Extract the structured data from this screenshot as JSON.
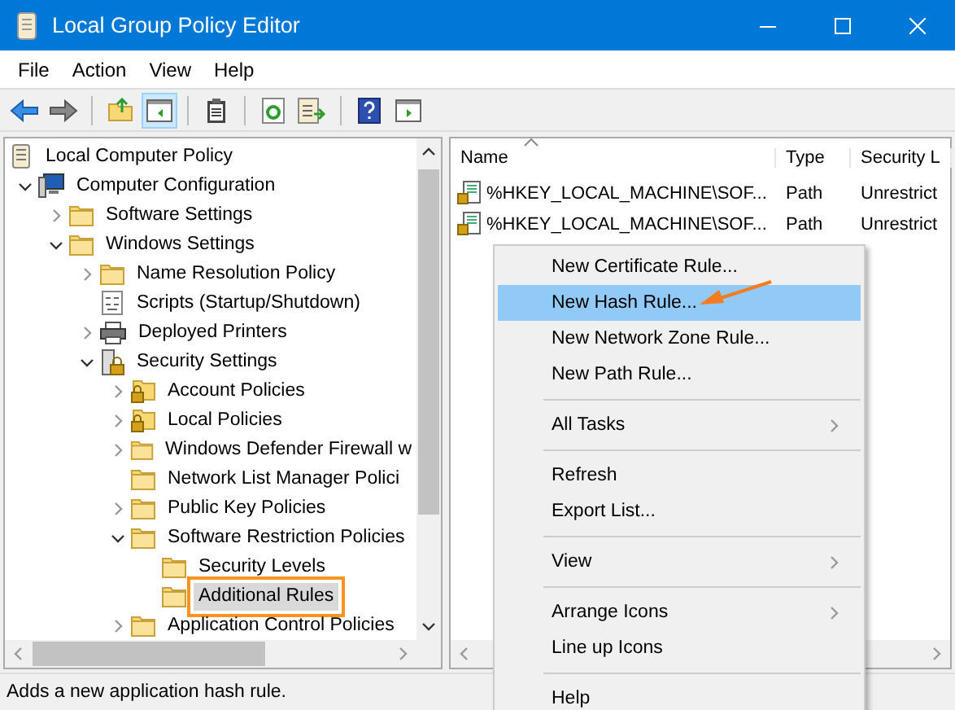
{
  "window": {
    "title": "Local Group Policy Editor"
  },
  "menu": [
    "File",
    "Action",
    "View",
    "Help"
  ],
  "toolbar": [
    {
      "kind": "back",
      "pressed": false
    },
    {
      "kind": "forward",
      "pressed": false
    },
    {
      "kind": "sep"
    },
    {
      "kind": "up",
      "pressed": false
    },
    {
      "kind": "tree",
      "pressed": true
    },
    {
      "kind": "sep"
    },
    {
      "kind": "clipboard",
      "pressed": false
    },
    {
      "kind": "sep"
    },
    {
      "kind": "refresh",
      "pressed": false
    },
    {
      "kind": "export",
      "pressed": false
    },
    {
      "kind": "sep"
    },
    {
      "kind": "help",
      "pressed": false
    },
    {
      "kind": "panel",
      "pressed": false
    }
  ],
  "tree": [
    {
      "label": "Local Computer Policy",
      "kind": "scroll",
      "expandable": false,
      "selected": false,
      "children": [
        {
          "label": "Computer Configuration",
          "kind": "computer",
          "expandable": true,
          "expanded": true,
          "selected": false,
          "children": [
            {
              "label": "Software Settings",
              "kind": "folder",
              "expandable": true,
              "expanded": false,
              "selected": false
            },
            {
              "label": "Windows Settings",
              "kind": "folder",
              "expandable": true,
              "expanded": true,
              "selected": false,
              "children": [
                {
                  "label": "Name Resolution Policy",
                  "kind": "folder",
                  "expandable": true,
                  "expanded": false,
                  "selected": false
                },
                {
                  "label": "Scripts (Startup/Shutdown)",
                  "kind": "script",
                  "expandable": false,
                  "selected": false
                },
                {
                  "label": "Deployed Printers",
                  "kind": "printer",
                  "expandable": true,
                  "expanded": false,
                  "selected": false
                },
                {
                  "label": "Security Settings",
                  "kind": "security",
                  "expandable": true,
                  "expanded": true,
                  "selected": false,
                  "children": [
                    {
                      "label": "Account Policies",
                      "kind": "lockfolder",
                      "expandable": true,
                      "expanded": false,
                      "selected": false
                    },
                    {
                      "label": "Local Policies",
                      "kind": "lockfolder",
                      "expandable": true,
                      "expanded": false,
                      "selected": false
                    },
                    {
                      "label": "Windows Defender Firewall w",
                      "kind": "folder",
                      "expandable": true,
                      "expanded": false,
                      "selected": false
                    },
                    {
                      "label": "Network List Manager Polici",
                      "kind": "folder",
                      "expandable": false,
                      "selected": false
                    },
                    {
                      "label": "Public Key Policies",
                      "kind": "folder",
                      "expandable": true,
                      "expanded": false,
                      "selected": false
                    },
                    {
                      "label": "Software Restriction Policies",
                      "kind": "folder",
                      "expandable": true,
                      "expanded": true,
                      "selected": false,
                      "children": [
                        {
                          "label": "Security Levels",
                          "kind": "folder",
                          "expandable": false,
                          "selected": false
                        },
                        {
                          "label": "Additional Rules",
                          "kind": "folder",
                          "expandable": false,
                          "selected": true
                        }
                      ]
                    },
                    {
                      "label": "Application Control Policies",
                      "kind": "folder",
                      "expandable": true,
                      "expanded": false,
                      "selected": false
                    }
                  ]
                }
              ]
            }
          ]
        }
      ]
    }
  ],
  "list": {
    "columns": [
      "Name",
      "Type",
      "Security L"
    ],
    "rows": [
      {
        "name": "%HKEY_LOCAL_MACHINE\\SOF...",
        "type": "Path",
        "security": "Unrestrict"
      },
      {
        "name": "%HKEY_LOCAL_MACHINE\\SOF...",
        "type": "Path",
        "security": "Unrestrict"
      }
    ]
  },
  "context_menu": [
    {
      "kind": "item",
      "label": "New Certificate Rule...",
      "submenu": false,
      "selected": false
    },
    {
      "kind": "item",
      "label": "New Hash Rule...",
      "submenu": false,
      "selected": true
    },
    {
      "kind": "item",
      "label": "New Network Zone Rule...",
      "submenu": false,
      "selected": false
    },
    {
      "kind": "item",
      "label": "New Path Rule...",
      "submenu": false,
      "selected": false
    },
    {
      "kind": "separator"
    },
    {
      "kind": "item",
      "label": "All Tasks",
      "submenu": true,
      "selected": false
    },
    {
      "kind": "separator"
    },
    {
      "kind": "item",
      "label": "Refresh",
      "submenu": false,
      "selected": false
    },
    {
      "kind": "item",
      "label": "Export List...",
      "submenu": false,
      "selected": false
    },
    {
      "kind": "separator"
    },
    {
      "kind": "item",
      "label": "View",
      "submenu": true,
      "selected": false
    },
    {
      "kind": "separator"
    },
    {
      "kind": "item",
      "label": "Arrange Icons",
      "submenu": true,
      "selected": false
    },
    {
      "kind": "item",
      "label": "Line up Icons",
      "submenu": false,
      "selected": false
    },
    {
      "kind": "separator"
    },
    {
      "kind": "item",
      "label": "Help",
      "submenu": false,
      "selected": false
    }
  ],
  "status_bar": "Adds a new application hash rule."
}
